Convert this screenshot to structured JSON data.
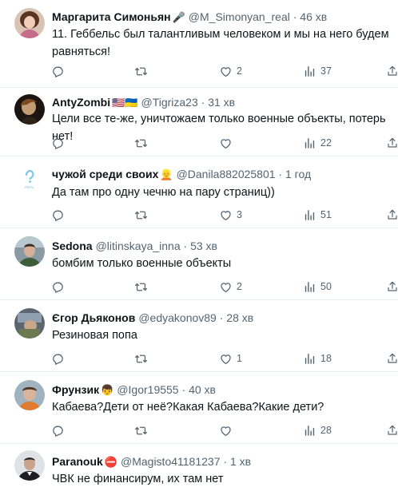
{
  "colors": {
    "text": "#0f1419",
    "muted": "#536471",
    "divider": "#e7ecef"
  },
  "tweets": [
    {
      "name": "Маргарита Симоньян",
      "badge": "🎤",
      "handle": "@M_Simonyan_real",
      "time": "46 хв",
      "text_lines": [
        "11. Геббельс был талантливым человеком и мы на него будем",
        "равняться!"
      ],
      "replies": "",
      "retweets": "",
      "likes": "2",
      "views": "37"
    },
    {
      "name": "AntyZombi",
      "badge": "🇺🇸🇺🇦",
      "handle": "@Tigriza23",
      "time": "31 хв",
      "text_lines": [
        "Цели все те-же, уничтожаем только военные объекты, потерь нет!"
      ],
      "replies": "",
      "retweets": "",
      "likes": "",
      "views": "22"
    },
    {
      "name": "чужой среди своих",
      "badge": "👱",
      "handle": "@Danila882025801",
      "time": "1 год",
      "text_lines": [
        "Да там про одну чечню на пару страниц))"
      ],
      "replies": "",
      "retweets": "",
      "likes": "3",
      "views": "51"
    },
    {
      "name": "Sedona",
      "badge": "",
      "handle": "@litinskaya_inna",
      "time": "53 хв",
      "text_lines": [
        "бомбим только военные объекты"
      ],
      "replies": "",
      "retweets": "",
      "likes": "2",
      "views": "50"
    },
    {
      "name": "Єгор Дьяконов",
      "badge": "",
      "handle": "@edyakonov89",
      "time": "28 хв",
      "text_lines": [
        "Резиновая попа"
      ],
      "replies": "",
      "retweets": "",
      "likes": "1",
      "views": "18"
    },
    {
      "name": "Фрунзик",
      "badge": "👦",
      "handle": "@Igor19555",
      "time": "40 хв",
      "text_lines": [
        "Кабаева?Дети от неё?Какая Кабаева?Какие дети?"
      ],
      "replies": "",
      "retweets": "",
      "likes": "",
      "views": "28"
    },
    {
      "name": "Paranouk",
      "badge": "⛔",
      "handle": "@Magisto41181237",
      "time": "1 хв",
      "text_lines": [
        "ЧВК не финансирум, их там нет"
      ],
      "replies": "",
      "retweets": "",
      "likes": "",
      "views": ""
    }
  ]
}
